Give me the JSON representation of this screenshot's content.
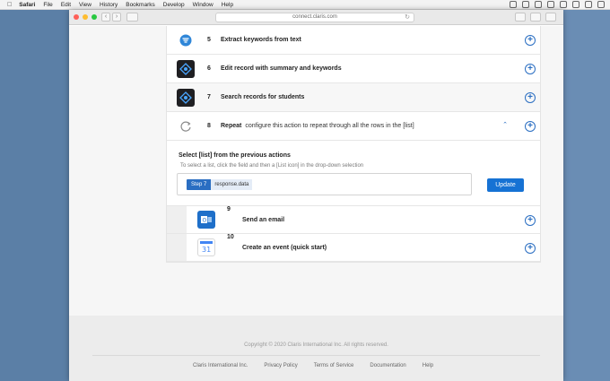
{
  "menubar": {
    "app": "Safari",
    "items": [
      "File",
      "Edit",
      "View",
      "History",
      "Bookmarks",
      "Develop",
      "Window",
      "Help"
    ]
  },
  "browser": {
    "url": "connect.claris.com"
  },
  "steps": [
    {
      "num": "5",
      "label": "Extract keywords from text",
      "icon": "nlp-icon"
    },
    {
      "num": "6",
      "label": "Edit record with summary and keywords",
      "icon": "filemaker-icon"
    },
    {
      "num": "7",
      "label": "Search records for students",
      "icon": "filemaker-icon"
    },
    {
      "num": "8",
      "label": "Repeat",
      "sublabel": "configure this action to repeat through all the rows in the [list]",
      "icon": "repeat-icon"
    }
  ],
  "config": {
    "title": "Select [list] from the previous actions",
    "help": "To select a list, click the field and then a [List icon] in the drop-down selection",
    "chip_step": "Step 7",
    "chip_value": "response.data",
    "update_label": "Update"
  },
  "nested_steps": [
    {
      "num": "9",
      "label": "Send an email",
      "icon": "outlook-icon"
    },
    {
      "num": "10",
      "label": "Create an event (quick start)",
      "icon": "calendar-icon",
      "icon_text": "31"
    }
  ],
  "footer": {
    "copyright": "Copyright © 2020 Claris International Inc. All rights reserved.",
    "links": [
      "Claris International Inc.",
      "Privacy Policy",
      "Terms of Service",
      "Documentation",
      "Help"
    ]
  },
  "colors": {
    "accent": "#2a6ec2",
    "button": "#1672d4",
    "desktop": "#5b7fa6"
  }
}
